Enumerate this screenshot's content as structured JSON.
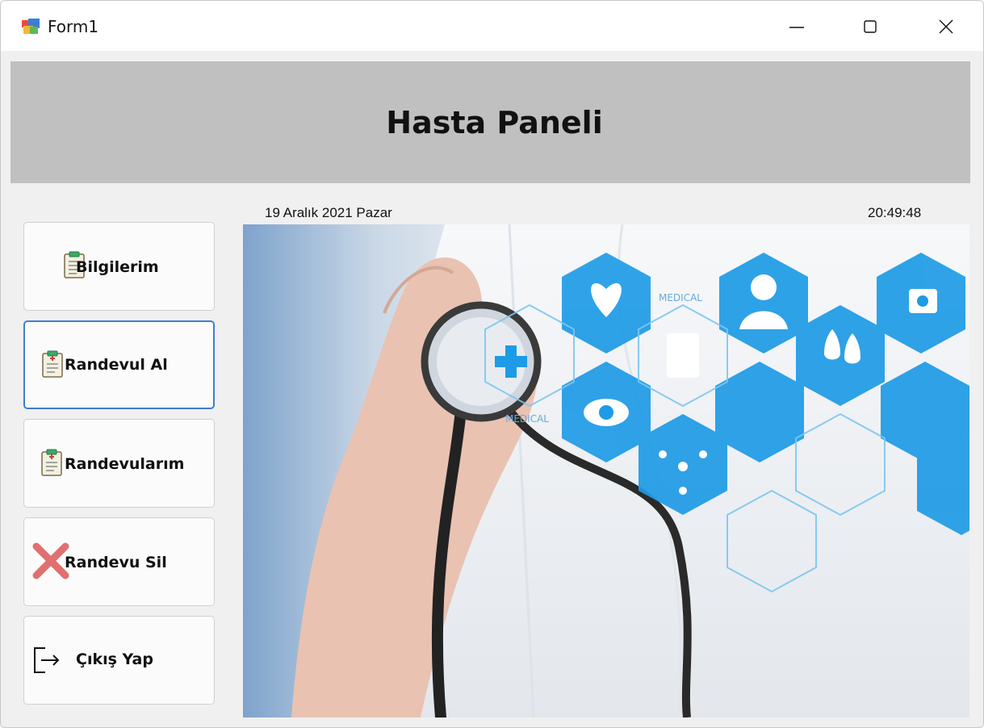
{
  "window": {
    "title": "Form1",
    "app_icon": "winforms-app-icon",
    "controls": [
      "minimize-icon",
      "maximize-icon",
      "close-icon"
    ]
  },
  "header": {
    "title": "Hasta Paneli",
    "background_color": "#c0c0c0"
  },
  "status": {
    "date": "19 Aralık 2021 Pazar",
    "time": "20:49:48"
  },
  "sidebar": {
    "items": [
      {
        "label": "Bilgilerim",
        "icon": "clipboard-icon"
      },
      {
        "label": "Randevul Al",
        "icon": "clipboard-icon",
        "focused": true
      },
      {
        "label": "Randevularım",
        "icon": "clipboard-icon"
      },
      {
        "label": "Randevu Sil",
        "icon": "red-x-icon"
      },
      {
        "label": "Çıkış Yap",
        "icon": "exit-icon"
      }
    ]
  },
  "image": {
    "overlay_texts": [
      "MEDICAL",
      "MEDICAL"
    ],
    "accent_color": "#1e9be6"
  }
}
